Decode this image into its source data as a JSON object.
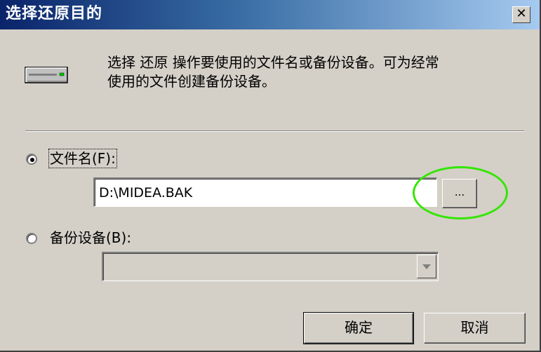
{
  "window": {
    "title": "选择还原目的",
    "close_label": "✕"
  },
  "icons": {
    "drive": "tape-drive-icon",
    "close": "close-icon",
    "dropdown": "chevron-down-icon"
  },
  "description": {
    "line1": "选择 还原 操作要使用的文件名或备份设备。可为经常",
    "line2": "使用的文件创建备份设备。"
  },
  "options": {
    "filename": {
      "label": "文件名(F):",
      "selected": true,
      "value": "D:\\MIDEA.BAK",
      "browse_label": "..."
    },
    "backup_device": {
      "label": "备份设备(B):",
      "selected": false,
      "value": ""
    }
  },
  "buttons": {
    "ok": "确定",
    "cancel": "取消"
  },
  "colors": {
    "titlebar_start": "#0a246a",
    "titlebar_end": "#a6caf0",
    "dialog_bg": "#d4d0c8",
    "highlight_ring": "#33e600"
  }
}
